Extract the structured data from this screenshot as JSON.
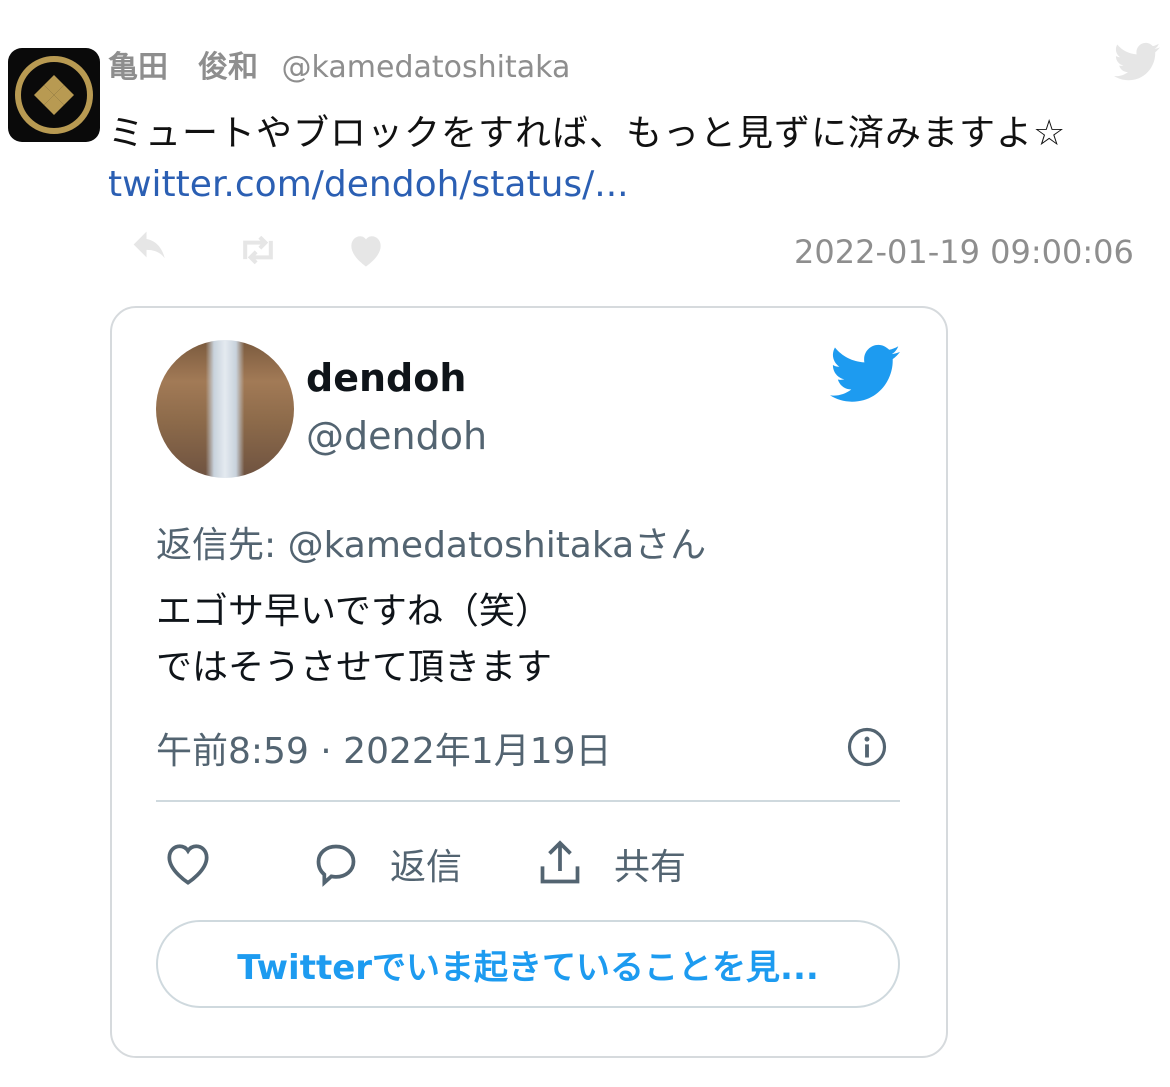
{
  "tweet": {
    "author_name": "亀田　俊和",
    "author_handle": "@kamedatoshitaka",
    "text": "ミュートやブロックをすれば、もっと見ずに済みますよ☆",
    "link": "twitter.com/dendoh/status/...",
    "timestamp": "2022-01-19 09:00:06",
    "icons": [
      "reply-icon",
      "retweet-icon",
      "like-icon",
      "twitter-bird-icon"
    ]
  },
  "embed": {
    "name": "dendoh",
    "handle": "@dendoh",
    "reply_to": "返信先: @kamedatoshitakaさん",
    "text_line1": "エゴサ早いですね（笑）",
    "text_line2": "ではそうさせて頂きます",
    "time": "午前8:59 · 2022年1月19日",
    "reply_label": "返信",
    "share_label": "共有",
    "cta_label": "Twitterでいま起きていることを見...",
    "colors": {
      "bird": "#1d9bf0",
      "link": "#2b5fb3",
      "cta": "#1d9bf0"
    }
  }
}
